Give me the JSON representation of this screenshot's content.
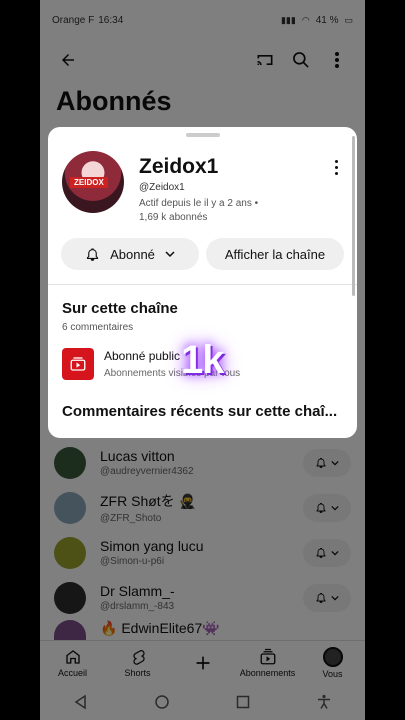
{
  "status_bar": {
    "carrier": "Orange F",
    "time": "16:34",
    "battery": "41 %"
  },
  "page": {
    "title": "Abonnés"
  },
  "subscribers": [
    {
      "name": "Lucas vitton",
      "handle": "@audreyvernier4362",
      "avatar_color": "#3b5b3a"
    },
    {
      "name": "ZFR Shøtを 🥷",
      "handle": "@ZFR_Shoto",
      "avatar_color": "#8aa7b8"
    },
    {
      "name": "Simon yang lucu",
      "handle": "@Simon-u-p6i",
      "avatar_color": "#9aa22a"
    },
    {
      "name": "Dr Slamm_-",
      "handle": "@drslamm_-843",
      "avatar_color": "#2c2c2c"
    },
    {
      "name": "🔥 EdwinElite67👾",
      "handle": "",
      "avatar_color": "#7a4f8a"
    }
  ],
  "sheet": {
    "channel_name": "Zeidox1",
    "channel_handle": "@Zeidox1",
    "meta_active": "Actif depuis le il y a 2 ans •",
    "meta_subs": "1,69 k abonnés",
    "avatar_tag": "ZEIDOX",
    "subscribed_label": "Abonné",
    "view_channel_label": "Afficher la chaîne",
    "about_title": "Sur cette chaîne",
    "comments_count": "6 commentaires",
    "public_sub_title": "Abonné public",
    "public_sub_desc": "Abonnements visibles par tous",
    "recent_comments_title": "Commentaires récents sur cette chaî..."
  },
  "watermark": "1k",
  "bottom_nav": [
    {
      "label": "Accueil",
      "icon": "home-icon"
    },
    {
      "label": "Shorts",
      "icon": "shorts-icon"
    },
    {
      "label": "",
      "icon": "create-icon"
    },
    {
      "label": "Abonnements",
      "icon": "subscriptions-icon"
    },
    {
      "label": "Vous",
      "icon": "profile-icon"
    }
  ],
  "colors": {
    "accent_red": "#d6141c",
    "overlay": "rgba(0,0,0,0.5)"
  }
}
